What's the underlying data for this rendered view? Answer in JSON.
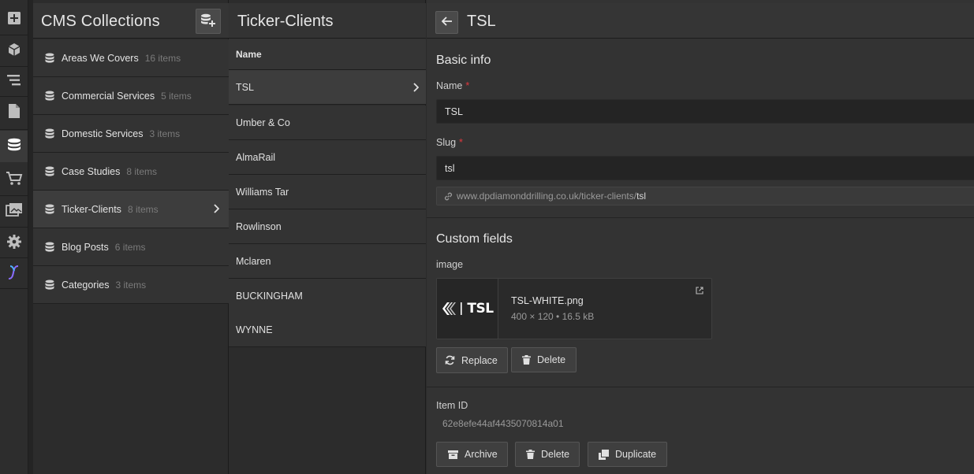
{
  "rail": {
    "items": [
      {
        "icon": "add-icon"
      },
      {
        "icon": "box-icon"
      },
      {
        "icon": "navigator-icon"
      },
      {
        "icon": "pages-icon"
      },
      {
        "icon": "database-icon",
        "active": true
      },
      {
        "icon": "cart-icon"
      },
      {
        "icon": "assets-icon"
      },
      {
        "icon": "settings-icon"
      },
      {
        "icon": "interactions-icon"
      }
    ]
  },
  "collections": {
    "title": "CMS Collections",
    "add_icon": "add-collection-icon",
    "items": [
      {
        "name": "Areas We Covers",
        "count": "16 items"
      },
      {
        "name": "Commercial Services",
        "count": "5 items"
      },
      {
        "name": "Domestic Services",
        "count": "3 items"
      },
      {
        "name": "Case Studies",
        "count": "8 items"
      },
      {
        "name": "Ticker-Clients",
        "count": "8 items",
        "active": true
      },
      {
        "name": "Blog Posts",
        "count": "6 items"
      },
      {
        "name": "Categories",
        "count": "3 items"
      }
    ]
  },
  "items_panel": {
    "title": "Ticker-Clients",
    "column_header": "Name",
    "rows": [
      {
        "name": "TSL",
        "active": true
      },
      {
        "name": "Umber & Co"
      },
      {
        "name": "AlmaRail"
      },
      {
        "name": "Williams Tar"
      },
      {
        "name": "Rowlinson"
      },
      {
        "name": "Mclaren"
      },
      {
        "name": "BUCKINGHAM"
      },
      {
        "name": "WYNNE"
      }
    ]
  },
  "editor": {
    "title": "TSL",
    "basic_info": {
      "heading": "Basic info",
      "name_label": "Name",
      "name_value": "TSL",
      "slug_label": "Slug",
      "slug_value": "tsl",
      "required_mark": "*",
      "url_prefix": "www.dpdiamonddrilling.co.uk/ticker-clients/",
      "url_slug": "tsl"
    },
    "custom_fields": {
      "heading": "Custom fields",
      "image_label": "image",
      "asset": {
        "filename": "TSL-WHITE.png",
        "meta": "400 × 120 • 16.5 kB",
        "thumb_text": "TSL"
      },
      "replace_label": "Replace",
      "delete_label": "Delete"
    },
    "item": {
      "id_label": "Item ID",
      "id_value": "62e8efe44af4435070814a01",
      "archive_label": "Archive",
      "delete_label": "Delete",
      "duplicate_label": "Duplicate"
    }
  },
  "colors": {
    "background": "#2b2b2b",
    "panel": "#333333",
    "active_row": "#3d3d3d",
    "input_bg": "#242424",
    "required": "#e0383e",
    "accent_interactions": "#8a6cff"
  }
}
